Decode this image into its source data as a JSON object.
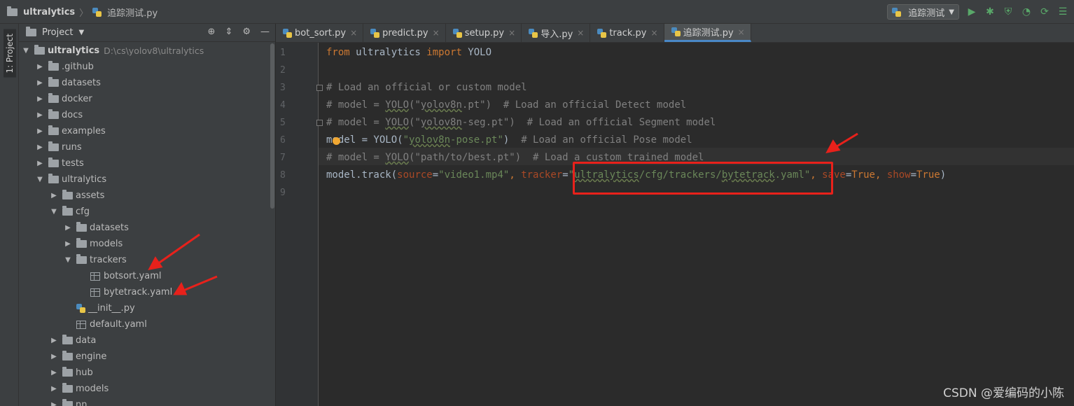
{
  "titlebar": {
    "project": "ultralytics",
    "file": "追踪测试.py",
    "run_config": "追踪测试"
  },
  "sidebar_tab": "1: Project",
  "project_panel": {
    "title": "Project",
    "tree": [
      {
        "label": "ultralytics",
        "path": "D:\\cs\\yolov8\\ultralytics",
        "depth": 0,
        "type": "folder",
        "expanded": true,
        "bold": true
      },
      {
        "label": ".github",
        "depth": 1,
        "type": "folder",
        "expanded": false
      },
      {
        "label": "datasets",
        "depth": 1,
        "type": "folder",
        "expanded": false
      },
      {
        "label": "docker",
        "depth": 1,
        "type": "folder",
        "expanded": false
      },
      {
        "label": "docs",
        "depth": 1,
        "type": "folder",
        "expanded": false
      },
      {
        "label": "examples",
        "depth": 1,
        "type": "folder",
        "expanded": false
      },
      {
        "label": "runs",
        "depth": 1,
        "type": "folder",
        "expanded": false
      },
      {
        "label": "tests",
        "depth": 1,
        "type": "folder",
        "expanded": false
      },
      {
        "label": "ultralytics",
        "depth": 1,
        "type": "folder",
        "expanded": true
      },
      {
        "label": "assets",
        "depth": 2,
        "type": "folder",
        "expanded": false
      },
      {
        "label": "cfg",
        "depth": 2,
        "type": "folder",
        "expanded": true
      },
      {
        "label": "datasets",
        "depth": 3,
        "type": "folder",
        "expanded": false
      },
      {
        "label": "models",
        "depth": 3,
        "type": "folder",
        "expanded": false
      },
      {
        "label": "trackers",
        "depth": 3,
        "type": "folder",
        "expanded": true
      },
      {
        "label": "botsort.yaml",
        "depth": 4,
        "type": "yaml"
      },
      {
        "label": "bytetrack.yaml",
        "depth": 4,
        "type": "yaml"
      },
      {
        "label": "__init__.py",
        "depth": 3,
        "type": "py"
      },
      {
        "label": "default.yaml",
        "depth": 3,
        "type": "yaml"
      },
      {
        "label": "data",
        "depth": 2,
        "type": "folder",
        "expanded": false
      },
      {
        "label": "engine",
        "depth": 2,
        "type": "folder",
        "expanded": false
      },
      {
        "label": "hub",
        "depth": 2,
        "type": "folder",
        "expanded": false
      },
      {
        "label": "models",
        "depth": 2,
        "type": "folder",
        "expanded": false
      },
      {
        "label": "nn",
        "depth": 2,
        "type": "folder",
        "expanded": false
      }
    ]
  },
  "tabs": [
    {
      "label": "bot_sort.py",
      "active": false
    },
    {
      "label": "predict.py",
      "active": false
    },
    {
      "label": "setup.py",
      "active": false
    },
    {
      "label": "导入.py",
      "active": false
    },
    {
      "label": "track.py",
      "active": false
    },
    {
      "label": "追踪测试.py",
      "active": true
    }
  ],
  "line_numbers": [
    "1",
    "2",
    "3",
    "4",
    "5",
    "6",
    "7",
    "8",
    "9"
  ],
  "code": {
    "l1_from": "from",
    "l1_mod": " ultralytics ",
    "l1_import": "import",
    "l1_name": " YOLO",
    "l3": "# Load an official or custom model",
    "l4_a": "# model = ",
    "l4_b": "YOLO",
    "l4_c": "(\"",
    "l4_d": "yolov8n",
    "l4_e": ".pt\")  # Load an official Detect model",
    "l5_a": "# model = ",
    "l5_b": "YOLO",
    "l5_c": "(\"",
    "l5_d": "yolov8n",
    "l5_e": "-seg.pt\")  # Load an official Segment model",
    "l6_a": "model = YOLO(",
    "l6_b": "\"",
    "l6_c": "yolov8n",
    "l6_d": "-pose.pt\"",
    "l6_e": ")  ",
    "l6_f": "# Load an official Pose model",
    "l7_a": "# model = ",
    "l7_b": "YOLO",
    "l7_c": "(\"path/to/best.pt\")  # Load a custom trained model",
    "l8_a": "model.track(",
    "l8_b": "source",
    "l8_c": "=",
    "l8_d": "\"video1.mp4\"",
    "l8_e": ", ",
    "l8_f": "tracker",
    "l8_g": "=",
    "l8_h": "\"",
    "l8_i": "ultralytics",
    "l8_j": "/cfg/trackers/",
    "l8_k": "bytetrack",
    "l8_l": ".yaml\"",
    "l8_m": ", ",
    "l8_n": "save",
    "l8_o": "=",
    "l8_p": "True",
    "l8_q": ", ",
    "l8_r": "show",
    "l8_s": "=",
    "l8_t": "True",
    "l8_u": ")"
  },
  "watermark": "CSDN @爱编码的小陈",
  "colors": {
    "annotation": "#e8211b",
    "active_tab_underline": "#4a88c7"
  }
}
